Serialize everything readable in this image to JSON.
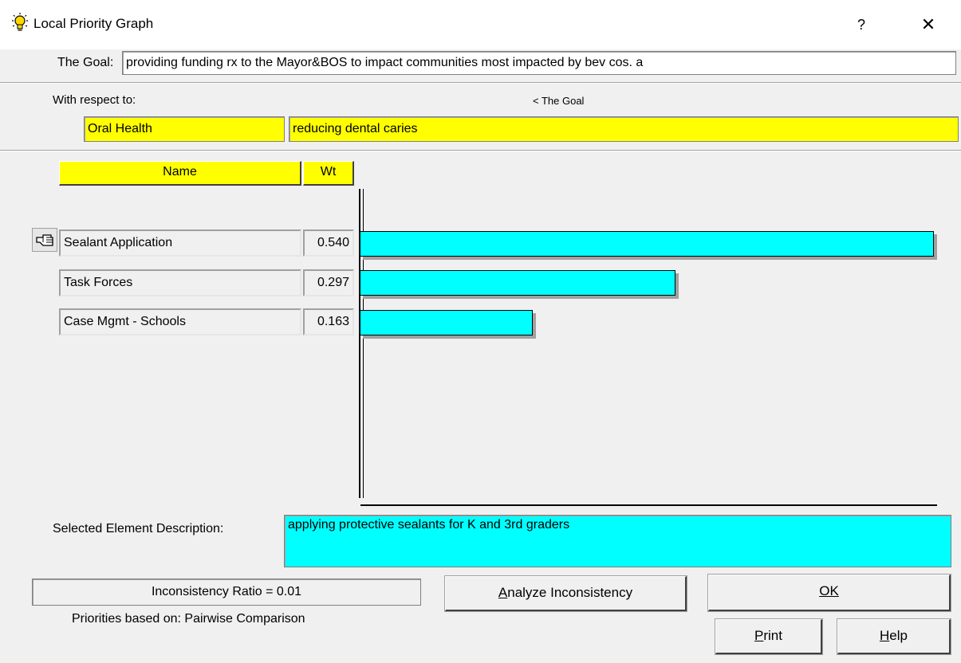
{
  "window": {
    "title": "Local Priority Graph",
    "help_glyph": "?",
    "close_glyph": "✕"
  },
  "goal": {
    "label": "The Goal:",
    "value": "providing funding rx to the Mayor&BOS to impact communities most impacted by bev cos. a"
  },
  "respect": {
    "label": "With respect to:",
    "path": "< The Goal",
    "node_name": "Oral Health",
    "node_description": "reducing dental caries"
  },
  "table": {
    "name_header": "Name",
    "wt_header": "Wt",
    "pointer_icon": "hand-pointer-icon"
  },
  "chart_data": {
    "type": "bar",
    "orientation": "horizontal",
    "categories": [
      "Sealant Application",
      "Task Forces",
      "Case Mgmt - Schools"
    ],
    "values": [
      0.54,
      0.297,
      0.163
    ],
    "value_labels": [
      "0.540",
      "0.297",
      "0.163"
    ],
    "bar_color": "#00ffff",
    "selected_index": 0
  },
  "description": {
    "label": "Selected Element Description:",
    "value": "applying protective sealants for K and 3rd graders"
  },
  "status": {
    "inconsistency": "Inconsistency Ratio = 0.01",
    "priorities": "Priorities based on:  Pairwise Comparison"
  },
  "buttons": {
    "analyze": "Analyze Inconsistency",
    "ok": "OK",
    "print": "Print",
    "help": "Help"
  }
}
